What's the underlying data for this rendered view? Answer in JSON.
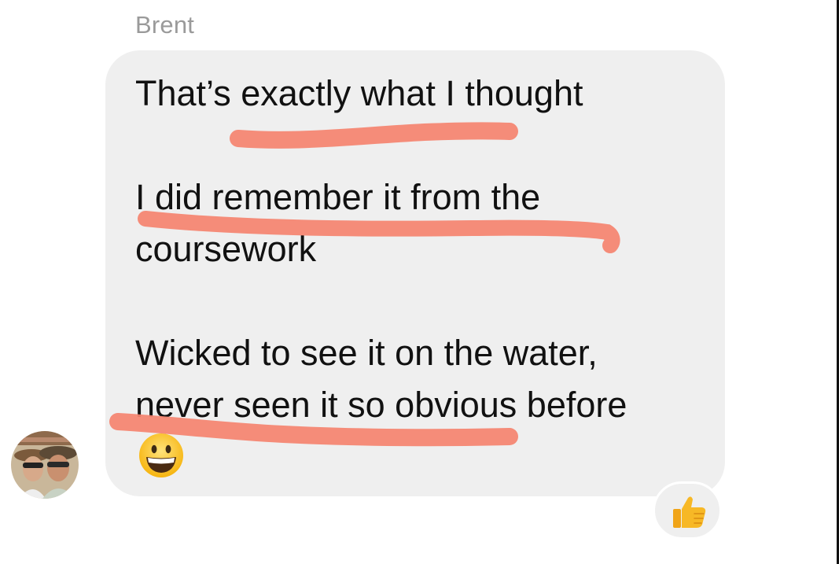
{
  "conversation": {
    "sender_name": "Brent",
    "message": {
      "lines": [
        "That’s exactly what I thought",
        "I did remember it from the",
        "coursework",
        "Wicked to see it on the water,",
        "never seen it so obvious before"
      ],
      "trailing_emoji": "grinning-face-emoji"
    },
    "reaction": "thumbs-up-emoji",
    "highlight_color": "#f5836f",
    "bubble_color": "#efefef"
  }
}
